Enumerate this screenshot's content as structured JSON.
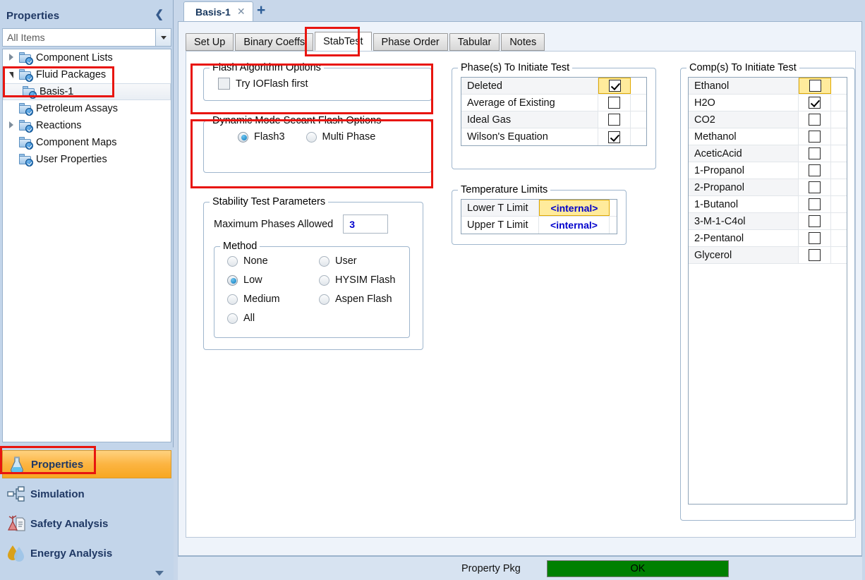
{
  "sidebar": {
    "title": "Properties",
    "collapse_icon": "chevron-left-icon",
    "search": {
      "value": "All Items",
      "dropdown_icon": "chevron-down-icon"
    },
    "tree": [
      {
        "label": "Component Lists",
        "twist": "collapsed",
        "indent": 0,
        "selected": false
      },
      {
        "label": "Fluid Packages",
        "twist": "expanded",
        "indent": 0,
        "selected": false
      },
      {
        "label": "Basis-1",
        "twist": "none",
        "indent": 1,
        "selected": true
      },
      {
        "label": "Petroleum Assays",
        "twist": "none",
        "indent": 0,
        "selected": false
      },
      {
        "label": "Reactions",
        "twist": "collapsed",
        "indent": 0,
        "selected": false
      },
      {
        "label": "Component Maps",
        "twist": "none",
        "indent": 0,
        "selected": false
      },
      {
        "label": "User Properties",
        "twist": "none",
        "indent": 0,
        "selected": false
      }
    ],
    "nav": [
      {
        "label": "Properties",
        "icon": "flask-icon",
        "active": true
      },
      {
        "label": "Simulation",
        "icon": "flowsheet-icon",
        "active": false
      },
      {
        "label": "Safety Analysis",
        "icon": "safety-icon",
        "active": false
      },
      {
        "label": "Energy Analysis",
        "icon": "energy-icon",
        "active": false
      }
    ]
  },
  "doc_tabs": {
    "tabs": [
      {
        "label": "Basis-1",
        "close_icon": "close-icon"
      }
    ],
    "new_tab_icon": "plus-icon"
  },
  "form_tabs": [
    {
      "label": "Set Up",
      "active": false
    },
    {
      "label": "Binary Coeffs",
      "active": false
    },
    {
      "label": "StabTest",
      "active": true
    },
    {
      "label": "Phase Order",
      "active": false
    },
    {
      "label": "Tabular",
      "active": false
    },
    {
      "label": "Notes",
      "active": false
    }
  ],
  "flash_algorithm": {
    "legend": "Flash Algorithm Options",
    "options": [
      {
        "label": "Try IOFlash first",
        "checked": false,
        "disabled": true
      }
    ]
  },
  "dynamic_mode": {
    "legend": "Dynamic Mode Secant Flash Options",
    "options": [
      {
        "label": "Flash3",
        "selected": true
      },
      {
        "label": "Multi Phase",
        "selected": false
      }
    ]
  },
  "stability_test": {
    "legend": "Stability Test Parameters",
    "max_phases_label": "Maximum Phases Allowed",
    "max_phases_value": "3",
    "method": {
      "legend": "Method",
      "left": [
        {
          "label": "None",
          "selected": false
        },
        {
          "label": "Low",
          "selected": true
        },
        {
          "label": "Medium",
          "selected": false
        },
        {
          "label": "All",
          "selected": false
        }
      ],
      "right": [
        {
          "label": "User",
          "selected": false
        },
        {
          "label": "HYSIM Flash",
          "selected": false
        },
        {
          "label": "Aspen Flash",
          "selected": false
        }
      ]
    }
  },
  "phases_to_initiate": {
    "legend": "Phase(s) To Initiate Test",
    "rows": [
      {
        "label": "Deleted",
        "checked": true,
        "highlighted": true
      },
      {
        "label": "Average of Existing",
        "checked": false,
        "highlighted": false
      },
      {
        "label": "Ideal Gas",
        "checked": false,
        "highlighted": false
      },
      {
        "label": "Wilson's Equation",
        "checked": true,
        "highlighted": false
      }
    ]
  },
  "temperature_limits": {
    "legend": "Temperature Limits",
    "rows": [
      {
        "label": "Lower T Limit",
        "value": "<internal>",
        "highlighted": true
      },
      {
        "label": "Upper T Limit",
        "value": "<internal>",
        "highlighted": false
      }
    ]
  },
  "comps_to_initiate": {
    "legend": "Comp(s) To Initiate Test",
    "rows": [
      {
        "label": "Ethanol",
        "checked": false,
        "highlighted": true
      },
      {
        "label": "H2O",
        "checked": true,
        "highlighted": false
      },
      {
        "label": "CO2",
        "checked": false,
        "highlighted": false
      },
      {
        "label": "Methanol",
        "checked": false,
        "highlighted": false
      },
      {
        "label": "AceticAcid",
        "checked": false,
        "highlighted": false
      },
      {
        "label": "1-Propanol",
        "checked": false,
        "highlighted": false
      },
      {
        "label": "2-Propanol",
        "checked": false,
        "highlighted": false
      },
      {
        "label": "1-Butanol",
        "checked": false,
        "highlighted": false
      },
      {
        "label": "3-M-1-C4ol",
        "checked": false,
        "highlighted": false
      },
      {
        "label": "2-Pentanol",
        "checked": false,
        "highlighted": false
      },
      {
        "label": "Glycerol",
        "checked": false,
        "highlighted": false
      }
    ]
  },
  "status_bar": {
    "property_pkg_label": "Property Pkg",
    "ok_label": "OK",
    "ok_color": "#008000"
  },
  "annotations": {
    "accent_color": "#e8150f"
  }
}
